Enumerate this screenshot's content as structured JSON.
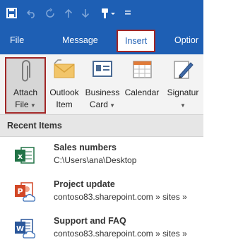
{
  "tabs": [
    {
      "label": "File"
    },
    {
      "label": "Message"
    },
    {
      "label": "Insert"
    },
    {
      "label": "Optior"
    }
  ],
  "ribbon": {
    "attach": {
      "line1": "Attach",
      "line2": "File"
    },
    "outlook_item": {
      "line1": "Outlook",
      "line2": "Item"
    },
    "business_card": {
      "line1": "Business",
      "line2": "Card"
    },
    "calendar": {
      "line1": "Calendar"
    },
    "signature": {
      "line1": "Signatur"
    }
  },
  "recent": {
    "title": "Recent Items",
    "items": [
      {
        "name": "Sales numbers",
        "path": "C:\\Users\\ana\\Desktop",
        "icon": "excel-icon"
      },
      {
        "name": "Project update",
        "path": "contoso83.sharepoint.com » sites »",
        "icon": "powerpoint-icon"
      },
      {
        "name": "Support and FAQ",
        "path": "contoso83.sharepoint.com » sites »",
        "icon": "word-icon"
      }
    ]
  },
  "colors": {
    "titlebar": "#1e5fb4",
    "highlight_border": "#a12626",
    "ribbon_bg": "#f3f3f3",
    "excel": "#217346",
    "powerpoint": "#d24726",
    "word": "#2b579a"
  }
}
